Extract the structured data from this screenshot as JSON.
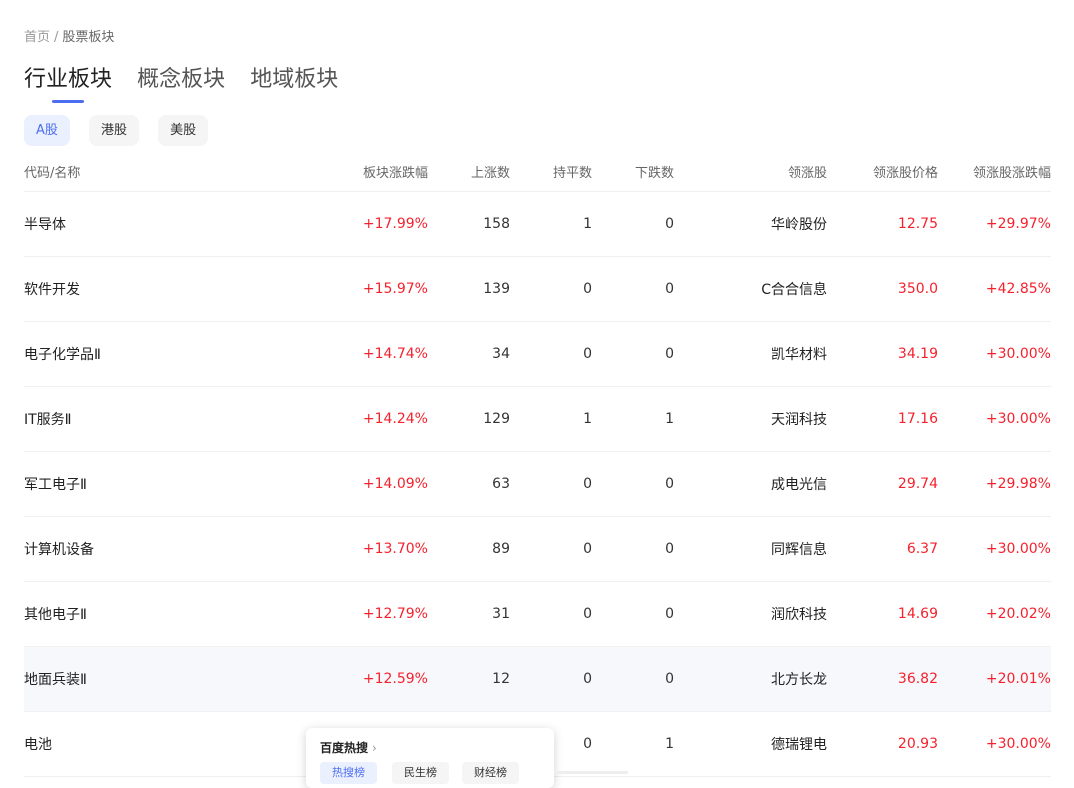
{
  "breadcrumb": {
    "home": "首页",
    "separator": "/",
    "current": "股票板块"
  },
  "main_tabs": [
    {
      "label": "行业板块",
      "active": true
    },
    {
      "label": "概念板块",
      "active": false
    },
    {
      "label": "地域板块",
      "active": false
    }
  ],
  "market_tabs": [
    {
      "label": "A股",
      "active": true
    },
    {
      "label": "港股",
      "active": false
    },
    {
      "label": "美股",
      "active": false
    }
  ],
  "table": {
    "headers": {
      "name": "代码/名称",
      "pct": "板块涨跌幅",
      "up": "上涨数",
      "flat": "持平数",
      "down": "下跌数",
      "lead": "领涨股",
      "price": "领涨股价格",
      "lead_pct": "领涨股涨跌幅"
    },
    "rows": [
      {
        "name": "半导体",
        "pct": "+17.99%",
        "up": "158",
        "flat": "1",
        "down": "0",
        "lead": "华岭股份",
        "price": "12.75",
        "lead_pct": "+29.97%"
      },
      {
        "name": "软件开发",
        "pct": "+15.97%",
        "up": "139",
        "flat": "0",
        "down": "0",
        "lead": "C合合信息",
        "price": "350.0",
        "lead_pct": "+42.85%"
      },
      {
        "name": "电子化学品Ⅱ",
        "pct": "+14.74%",
        "up": "34",
        "flat": "0",
        "down": "0",
        "lead": "凯华材料",
        "price": "34.19",
        "lead_pct": "+30.00%"
      },
      {
        "name": "IT服务Ⅱ",
        "pct": "+14.24%",
        "up": "129",
        "flat": "1",
        "down": "1",
        "lead": "天润科技",
        "price": "17.16",
        "lead_pct": "+30.00%"
      },
      {
        "name": "军工电子Ⅱ",
        "pct": "+14.09%",
        "up": "63",
        "flat": "0",
        "down": "0",
        "lead": "成电光信",
        "price": "29.74",
        "lead_pct": "+29.98%"
      },
      {
        "name": "计算机设备",
        "pct": "+13.70%",
        "up": "89",
        "flat": "0",
        "down": "0",
        "lead": "同辉信息",
        "price": "6.37",
        "lead_pct": "+30.00%"
      },
      {
        "name": "其他电子Ⅱ",
        "pct": "+12.79%",
        "up": "31",
        "flat": "0",
        "down": "0",
        "lead": "润欣科技",
        "price": "14.69",
        "lead_pct": "+20.02%"
      },
      {
        "name": "地面兵装Ⅱ",
        "pct": "+12.59%",
        "up": "12",
        "flat": "0",
        "down": "0",
        "lead": "北方长龙",
        "price": "36.82",
        "lead_pct": "+20.01%"
      },
      {
        "name": "电池",
        "pct": "",
        "up": "",
        "flat": "0",
        "down": "1",
        "lead": "德瑞锂电",
        "price": "20.93",
        "lead_pct": "+30.00%"
      }
    ]
  },
  "popup": {
    "title": "百度热搜",
    "tabs": [
      {
        "label": "热搜榜",
        "active": true
      },
      {
        "label": "民生榜",
        "active": false
      },
      {
        "label": "财经榜",
        "active": false
      }
    ]
  },
  "colors": {
    "accent": "#4e6ef2",
    "rise": "#f5222d",
    "highlight_row": "#f6f8fc"
  },
  "icons": {
    "popup_arrow": "chevron-right-icon"
  }
}
